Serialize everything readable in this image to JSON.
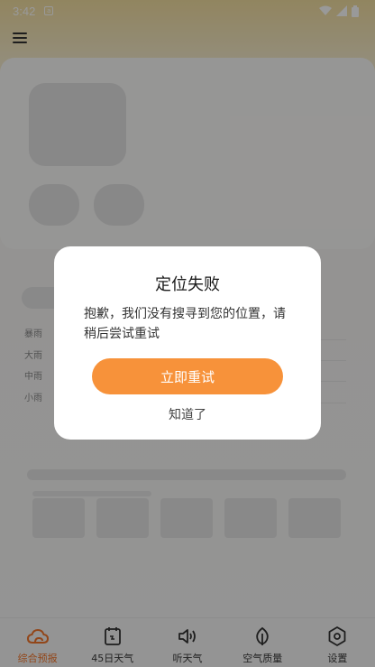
{
  "status_bar": {
    "time": "3:42",
    "notification_icon": "a",
    "icons": [
      "wifi-icon",
      "signal-icon",
      "battery-icon"
    ]
  },
  "menu": {
    "icon": "menu-icon"
  },
  "rain_legend": [
    "暴雨",
    "大雨",
    "中雨",
    "小雨"
  ],
  "dialog": {
    "title": "定位失败",
    "message": "抱歉，我们没有搜寻到您的位置，请稍后尝试重试",
    "retry_label": "立即重试",
    "dismiss_label": "知道了"
  },
  "tabs": [
    {
      "label": "综合预报",
      "icon": "cloud-icon",
      "active": true
    },
    {
      "label": "45日天气",
      "icon": "calendar-icon",
      "active": false
    },
    {
      "label": "听天气",
      "icon": "speaker-icon",
      "active": false
    },
    {
      "label": "空气质量",
      "icon": "leaf-icon",
      "active": false
    },
    {
      "label": "设置",
      "icon": "settings-icon",
      "active": false
    }
  ],
  "colors": {
    "accent": "#f7923a",
    "active_tab": "#f4752a",
    "overlay": "rgba(0,0,0,0.40)"
  }
}
